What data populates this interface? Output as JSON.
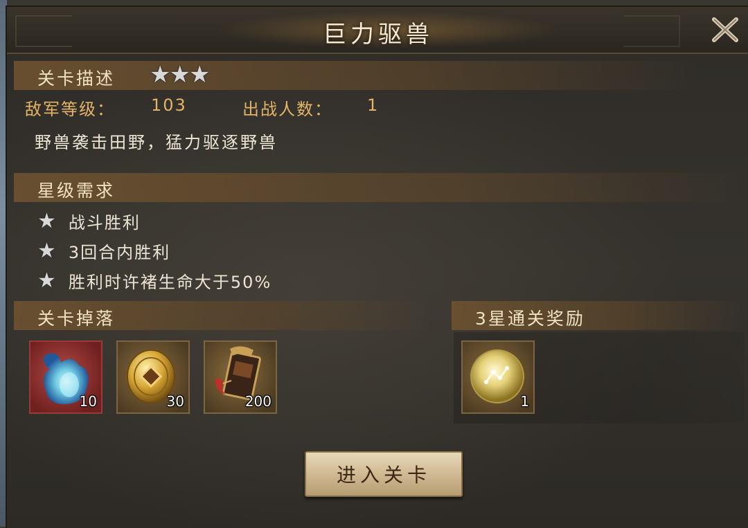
{
  "dialog": {
    "title": "巨力驱兽",
    "close_icon": "close-x-icon"
  },
  "stage_description": {
    "header": "关卡描述",
    "stars": "★★★",
    "enemy_level_label": "敌军等级：",
    "enemy_level": "103",
    "troops_label": "出战人数：",
    "troops": "1",
    "text": "野兽袭击田野，猛力驱逐野兽"
  },
  "star_requirements": {
    "header": "星级需求",
    "items": [
      {
        "icon": "star-icon",
        "text": "战斗胜利"
      },
      {
        "icon": "star-icon",
        "text": "3回合内胜利"
      },
      {
        "icon": "star-icon",
        "text": "胜利时许褚生命大于50%"
      }
    ]
  },
  "drops": {
    "header": "关卡掉落",
    "items": [
      {
        "icon": "blue-flame-gem-icon",
        "count": "10"
      },
      {
        "icon": "gold-coin-icon",
        "count": "30"
      },
      {
        "icon": "token-scroll-icon",
        "count": "200"
      }
    ]
  },
  "three_star_reward": {
    "header": "3星通关奖励",
    "items": [
      {
        "icon": "golden-orb-icon",
        "count": "1"
      }
    ]
  },
  "enter_button": "进入关卡",
  "colors": {
    "accent_gold": "#e3b467",
    "section_bar": "#6e5230",
    "button_face": "#cdb690"
  }
}
